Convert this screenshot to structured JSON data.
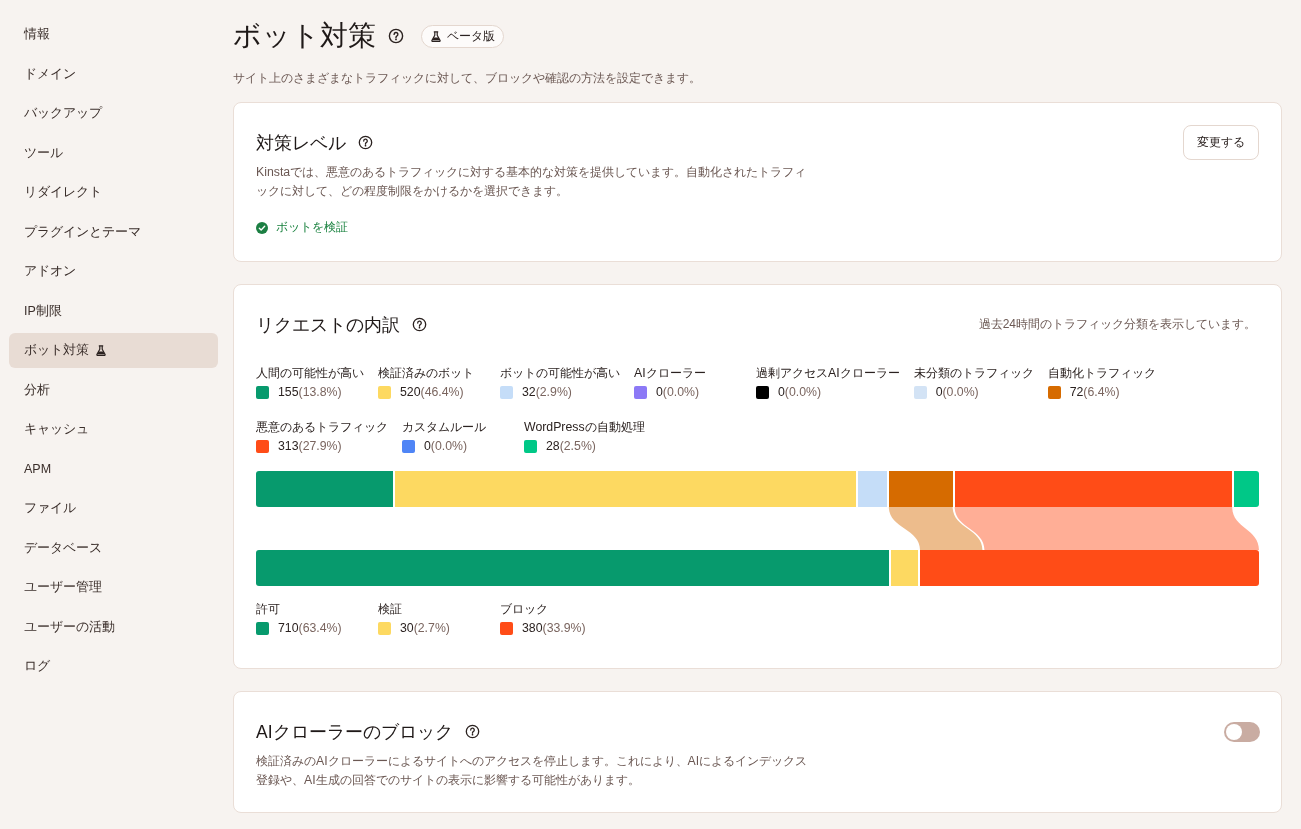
{
  "sidebar": {
    "items": [
      {
        "label": "情報",
        "selected": false,
        "beta": false
      },
      {
        "label": "ドメイン",
        "selected": false,
        "beta": false
      },
      {
        "label": "バックアップ",
        "selected": false,
        "beta": false
      },
      {
        "label": "ツール",
        "selected": false,
        "beta": false
      },
      {
        "label": "リダイレクト",
        "selected": false,
        "beta": false
      },
      {
        "label": "プラグインとテーマ",
        "selected": false,
        "beta": false
      },
      {
        "label": "アドオン",
        "selected": false,
        "beta": false
      },
      {
        "label": "IP制限",
        "selected": false,
        "beta": false
      },
      {
        "label": "ボット対策",
        "selected": true,
        "beta": true
      },
      {
        "label": "分析",
        "selected": false,
        "beta": false
      },
      {
        "label": "キャッシュ",
        "selected": false,
        "beta": false
      },
      {
        "label": "APM",
        "selected": false,
        "beta": false
      },
      {
        "label": "ファイル",
        "selected": false,
        "beta": false
      },
      {
        "label": "データベース",
        "selected": false,
        "beta": false
      },
      {
        "label": "ユーザー管理",
        "selected": false,
        "beta": false
      },
      {
        "label": "ユーザーの活動",
        "selected": false,
        "beta": false
      },
      {
        "label": "ログ",
        "selected": false,
        "beta": false
      }
    ]
  },
  "header": {
    "title": "ボット対策",
    "badge": "ベータ版",
    "subtitle": "サイト上のさまざまなトラフィックに対して、ブロックや確認の方法を設定できます。"
  },
  "protection_level": {
    "title": "対策レベル",
    "description": "Kinstaでは、悪意のあるトラフィックに対する基本的な対策を提供しています。自動化されたトラフィックに対して、どの程度制限をかけるかを選択できます。",
    "status": "ボットを検証",
    "button": "変更する"
  },
  "request_breakdown": {
    "title": "リクエストの内訳",
    "period_note": "過去24時間のトラフィック分類を表示しています。",
    "categories": [
      {
        "label": "人間の可能性が高い",
        "color": "#079a6d",
        "count": "155",
        "share": "(13.8%)"
      },
      {
        "label": "検証済みのボット",
        "color": "#fdd961",
        "count": "520",
        "share": "(46.4%)"
      },
      {
        "label": "ボットの可能性が高い",
        "color": "#c5ddf8",
        "count": "32",
        "share": "(2.9%)"
      },
      {
        "label": "AIクローラー",
        "color": "#8c79f6",
        "count": "0",
        "share": "(0.0%)"
      },
      {
        "label": "過剰アクセスAIクローラー",
        "color": "#000000",
        "count": "0",
        "share": "(0.0%)"
      },
      {
        "label": "未分類のトラフィック",
        "color": "#d3e3f5",
        "count": "0",
        "share": "(0.0%)"
      },
      {
        "label": "自動化トラフィック",
        "color": "#d66b00",
        "count": "72",
        "share": "(6.4%)"
      },
      {
        "label": "悪意のあるトラフィック",
        "color": "#ff4c17",
        "count": "313",
        "share": "(27.9%)"
      },
      {
        "label": "カスタムルール",
        "color": "#4f85f6",
        "count": "0",
        "share": "(0.0%)"
      },
      {
        "label": "WordPressの自動処理",
        "color": "#00c887",
        "count": "28",
        "share": "(2.5%)"
      }
    ],
    "outcomes": [
      {
        "label": "許可",
        "color": "#079a6d",
        "count": "710",
        "share": "(63.4%)"
      },
      {
        "label": "検証",
        "color": "#fdd961",
        "count": "30",
        "share": "(2.7%)"
      },
      {
        "label": "ブロック",
        "color": "#ff4c17",
        "count": "380",
        "share": "(33.9%)"
      }
    ]
  },
  "ai_crawler_block": {
    "title": "AIクローラーのブロック",
    "description": "検証済みのAIクローラーによるサイトへのアクセスを停止します。これにより、AIによるインデックス登録や、AI生成の回答でのサイトの表示に影響する可能性があります。",
    "on": false
  }
}
